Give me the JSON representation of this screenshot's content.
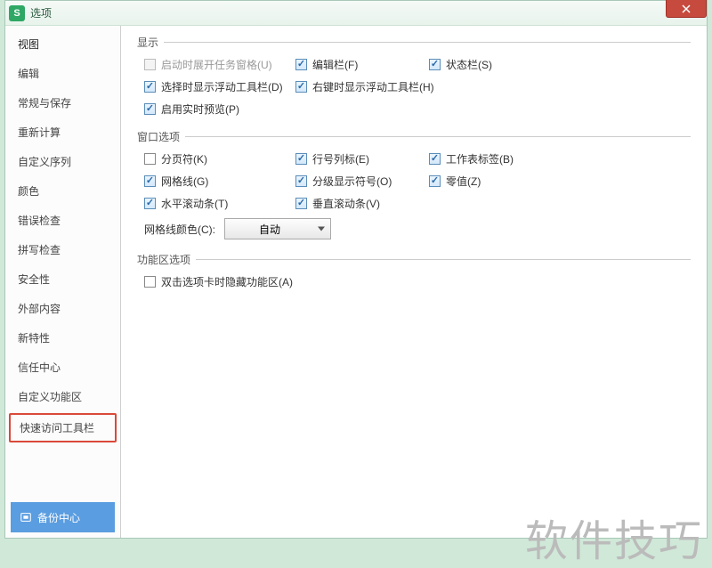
{
  "window": {
    "title": "选项"
  },
  "sidebar": {
    "items": [
      {
        "label": "视图"
      },
      {
        "label": "编辑"
      },
      {
        "label": "常规与保存"
      },
      {
        "label": "重新计算"
      },
      {
        "label": "自定义序列"
      },
      {
        "label": "颜色"
      },
      {
        "label": "错误检查"
      },
      {
        "label": "拼写检查"
      },
      {
        "label": "安全性"
      },
      {
        "label": "外部内容"
      },
      {
        "label": "新特性"
      },
      {
        "label": "信任中心"
      },
      {
        "label": "自定义功能区"
      },
      {
        "label": "快速访问工具栏"
      }
    ],
    "backup": "备份中心"
  },
  "groups": {
    "display": {
      "title": "显示",
      "opts": {
        "startup": "启动时展开任务窗格(U)",
        "editbar": "编辑栏(F)",
        "statusbar": "状态栏(S)",
        "selfloat": "选择时显示浮动工具栏(D)",
        "rightfloat": "右键时显示浮动工具栏(H)",
        "preview": "启用实时预览(P)"
      }
    },
    "winopt": {
      "title": "窗口选项",
      "opts": {
        "pagebreak": "分页符(K)",
        "rowcol": "行号列标(E)",
        "sheettab": "工作表标签(B)",
        "gridline": "网格线(G)",
        "outline": "分级显示符号(O)",
        "zero": "零值(Z)",
        "hscroll": "水平滚动条(T)",
        "vscroll": "垂直滚动条(V)"
      },
      "colorLabel": "网格线颜色(C):",
      "colorValue": "自动"
    },
    "ribbon": {
      "title": "功能区选项",
      "opts": {
        "dblclick": "双击选项卡时隐藏功能区(A)"
      }
    }
  },
  "watermark": "软件技巧"
}
